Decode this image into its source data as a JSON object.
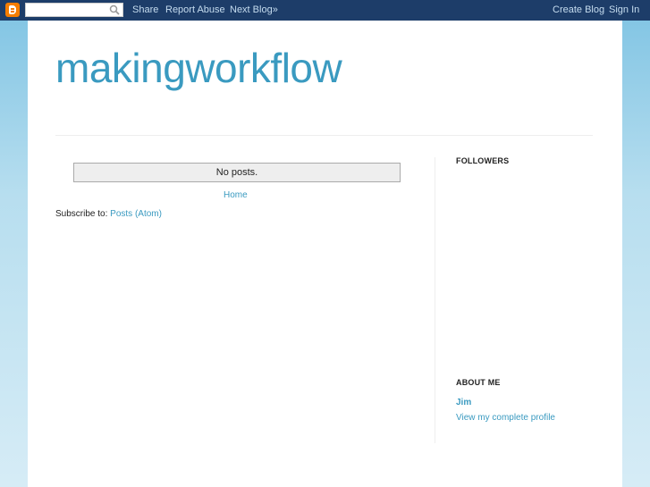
{
  "navbar": {
    "search_placeholder": "",
    "share_label": "Share",
    "report_label": "Report Abuse",
    "next_blog_label": "Next Blog»",
    "create_blog_label": "Create Blog",
    "sign_in_label": "Sign In"
  },
  "blog": {
    "title": "makingworkflow"
  },
  "main": {
    "no_posts": "No posts.",
    "home_link": "Home",
    "subscribe_prefix": "Subscribe to: ",
    "subscribe_link": "Posts (Atom)"
  },
  "sidebar": {
    "followers_heading": "FOLLOWERS",
    "about_heading": "ABOUT ME",
    "author_name": "Jim",
    "profile_link": "View my complete profile"
  },
  "colors": {
    "navbar_bg": "#1d3d69",
    "link": "#3a9ac0",
    "logo": "#f57d00"
  }
}
